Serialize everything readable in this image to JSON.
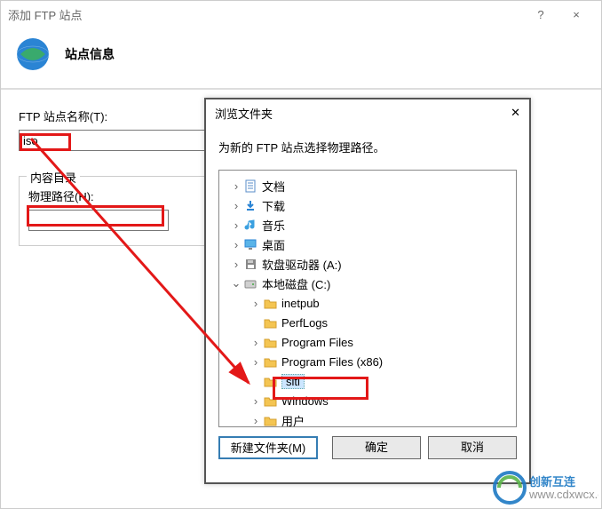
{
  "main": {
    "window_title": "添加 FTP 站点",
    "help_label": "?",
    "close_label": "×",
    "header_title": "站点信息",
    "site_name_label": "FTP 站点名称(T):",
    "site_name_value": "iso",
    "content_dir_group": "内容目录",
    "physical_path_label": "物理路径(H):",
    "physical_path_value": ""
  },
  "browse": {
    "title": "浏览文件夹",
    "close_label": "✕",
    "message": "为新的 FTP 站点选择物理路径。",
    "tree": [
      {
        "level": 0,
        "expander": ">",
        "icon": "document",
        "label": "文档"
      },
      {
        "level": 0,
        "expander": ">",
        "icon": "download",
        "label": "下载"
      },
      {
        "level": 0,
        "expander": ">",
        "icon": "music",
        "label": "音乐"
      },
      {
        "level": 0,
        "expander": ">",
        "icon": "desktop",
        "label": "桌面"
      },
      {
        "level": 0,
        "expander": ">",
        "icon": "floppy",
        "label": "软盘驱动器 (A:)"
      },
      {
        "level": 0,
        "expander": "v",
        "icon": "disk",
        "label": "本地磁盘 (C:)"
      },
      {
        "level": 1,
        "expander": ">",
        "icon": "folder",
        "label": "inetpub"
      },
      {
        "level": 1,
        "expander": "",
        "icon": "folder",
        "label": "PerfLogs"
      },
      {
        "level": 1,
        "expander": ">",
        "icon": "folder",
        "label": "Program Files"
      },
      {
        "level": 1,
        "expander": ">",
        "icon": "folder",
        "label": "Program Files (x86)"
      },
      {
        "level": 1,
        "expander": "",
        "icon": "folder",
        "label": "siti",
        "selected": true
      },
      {
        "level": 1,
        "expander": ">",
        "icon": "folder",
        "label": "Windows"
      },
      {
        "level": 1,
        "expander": ">",
        "icon": "folder",
        "label": "用户"
      }
    ],
    "new_folder_btn": "新建文件夹(M)",
    "ok_btn": "确定",
    "cancel_btn": "取消"
  },
  "watermark": {
    "brand1": "创新互连",
    "brand2": "www.cdxwcx.com"
  }
}
